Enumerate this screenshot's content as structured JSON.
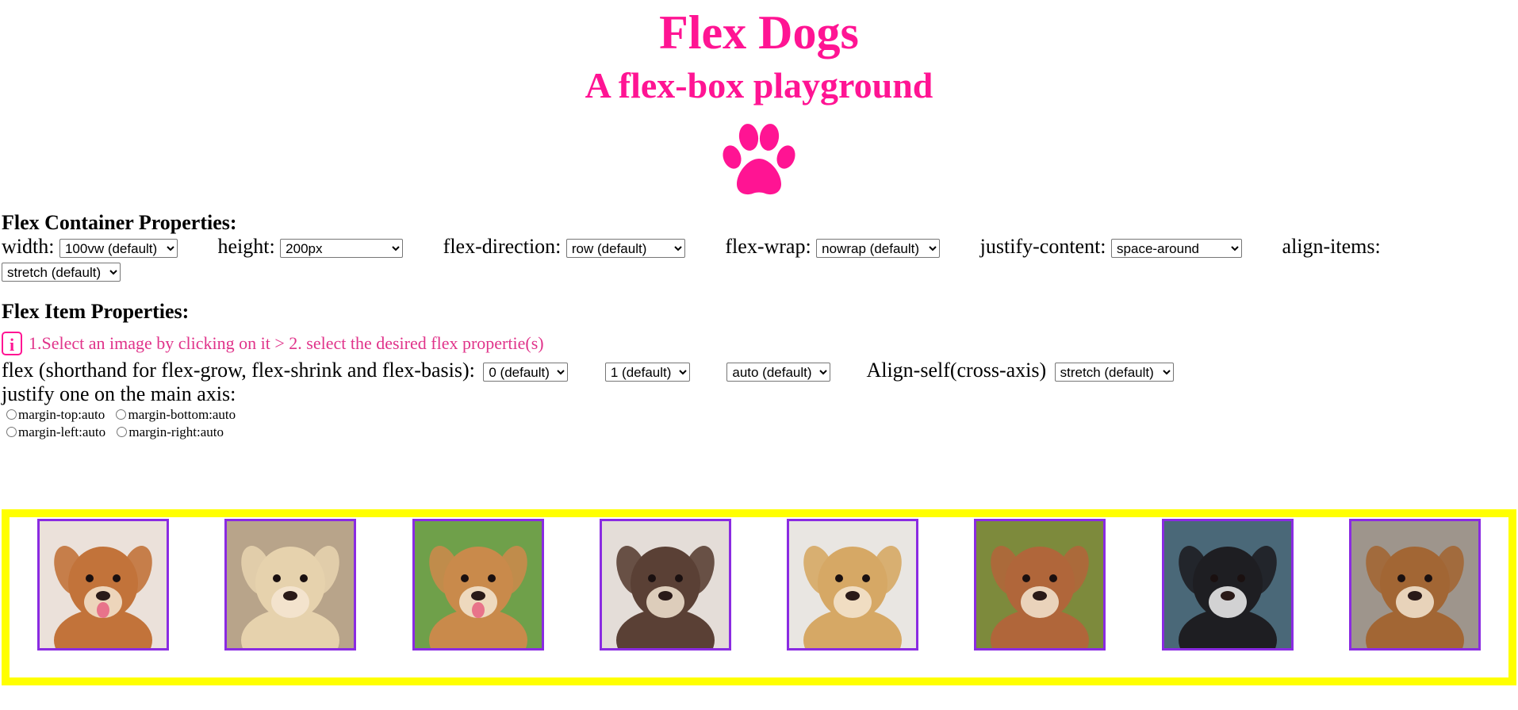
{
  "header": {
    "title": "Flex Dogs",
    "subtitle": "A flex-box playground",
    "logo_icon": "paw-icon",
    "brand_color": "#ff1493"
  },
  "container_props": {
    "heading": "Flex Container Properties:",
    "width": {
      "label": "width:",
      "value": "100vw (default)"
    },
    "height": {
      "label": "height:",
      "value": "200px"
    },
    "flex_direction": {
      "label": "flex-direction:",
      "value": "row (default)"
    },
    "flex_wrap": {
      "label": "flex-wrap:",
      "value": "nowrap (default)"
    },
    "justify_content": {
      "label": "justify-content:",
      "value": "space-around"
    },
    "align_items": {
      "label": "align-items:",
      "value": "stretch (default)"
    }
  },
  "item_props": {
    "heading": "Flex Item Properties:",
    "info_icon": "i",
    "info_text": "1.Select an image by clicking on it > 2. select the desired flex propertie(s)",
    "flex_label": "flex (shorthand for flex-grow, flex-shrink and flex-basis):",
    "flex_grow": "0 (default)",
    "flex_shrink": "1 (default)",
    "flex_basis": "auto (default)",
    "align_self_label": "Align-self(cross-axis)",
    "align_self": "stretch (default)",
    "justify_label": "justify one on the main axis:",
    "radios": {
      "margin_top": "margin-top:auto",
      "margin_bottom": "margin-bottom:auto",
      "margin_left": "margin-left:auto",
      "margin_right": "margin-right:auto"
    }
  },
  "dog_container": {
    "border_color": "#ffff00",
    "item_border_color": "#8a2be2",
    "dogs": [
      {
        "name": "nova-scotia-duck-tolling-retriever",
        "fur": "#c2733a",
        "bg": "#ebe1da"
      },
      {
        "name": "golden-retriever-puppy",
        "fur": "#e6d2ad",
        "bg": "#b8a48a"
      },
      {
        "name": "corgi",
        "fur": "#c98a4b",
        "bg": "#6fa04a"
      },
      {
        "name": "brown-poodle",
        "fur": "#5a4035",
        "bg": "#e4ddd8"
      },
      {
        "name": "golden-selfie",
        "fur": "#d6a865",
        "bg": "#e9e6e2"
      },
      {
        "name": "vizsla",
        "fur": "#b0663a",
        "bg": "#7d8a3c"
      },
      {
        "name": "border-collie",
        "fur": "#1e1e22",
        "bg": "#4a6878"
      },
      {
        "name": "boxer-puppy",
        "fur": "#a26634",
        "bg": "#9e958c"
      }
    ]
  }
}
